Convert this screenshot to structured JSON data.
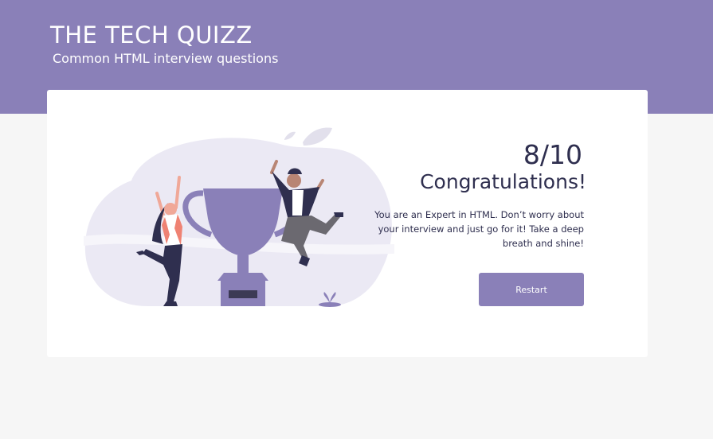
{
  "header": {
    "title": "THE TECH QUIZZ",
    "subtitle": "Common HTML interview questions"
  },
  "result": {
    "score": "8/10",
    "heading": "Congratulations!",
    "message": "You are an Expert in HTML. Don’t worry about your interview and just go for it! Take a deep breath and shine!",
    "restart_label": "Restart"
  },
  "illustration": {
    "icon": "celebration-trophy-illustration"
  },
  "colors": {
    "accent": "#8a80b8",
    "text": "#2f2f4f",
    "background": "#f6f6f6",
    "card": "#ffffff"
  }
}
